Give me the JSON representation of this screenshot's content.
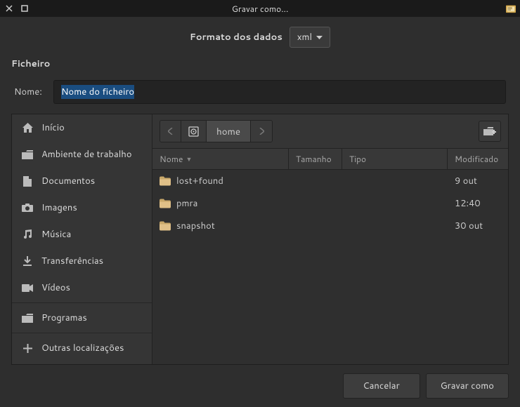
{
  "titlebar": {
    "title": "Gravar como..."
  },
  "format": {
    "label": "Formato dos dados",
    "selected": "xml"
  },
  "file_section": {
    "label": "Ficheiro"
  },
  "name_field": {
    "label": "Nome:",
    "value": "Nome do ficheiro"
  },
  "sidebar": {
    "items": [
      {
        "label": "Início",
        "icon": "home"
      },
      {
        "label": "Ambiente de trabalho",
        "icon": "folder"
      },
      {
        "label": "Documentos",
        "icon": "doc"
      },
      {
        "label": "Imagens",
        "icon": "camera"
      },
      {
        "label": "Música",
        "icon": "music"
      },
      {
        "label": "Transferências",
        "icon": "download"
      },
      {
        "label": "Vídeos",
        "icon": "video"
      }
    ],
    "items2": [
      {
        "label": "Programas",
        "icon": "folder"
      }
    ],
    "items3": [
      {
        "label": "Outras localizações",
        "icon": "plus"
      }
    ]
  },
  "pathbar": {
    "current": "home"
  },
  "table": {
    "headers": {
      "name": "Nome",
      "size": "Tamanho",
      "type": "Tipo",
      "modified": "Modificado"
    },
    "rows": [
      {
        "name": "lost+found",
        "size": "",
        "type": "",
        "modified": "9 out"
      },
      {
        "name": "pmra",
        "size": "",
        "type": "",
        "modified": "12:40"
      },
      {
        "name": "snapshot",
        "size": "",
        "type": "",
        "modified": "30 out"
      }
    ]
  },
  "actions": {
    "cancel": "Cancelar",
    "save": "Gravar como"
  }
}
